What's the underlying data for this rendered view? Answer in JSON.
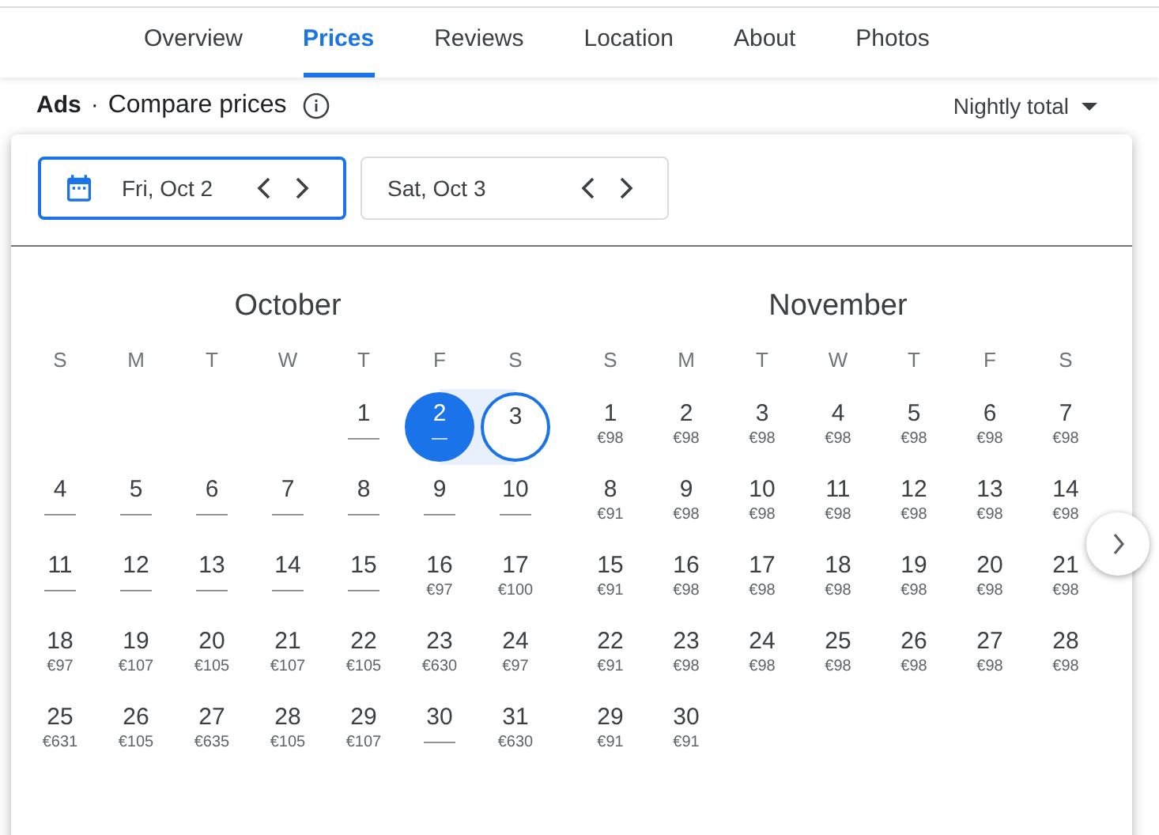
{
  "tabs": [
    {
      "label": "Overview",
      "selected": false
    },
    {
      "label": "Prices",
      "selected": true
    },
    {
      "label": "Reviews",
      "selected": false
    },
    {
      "label": "Location",
      "selected": false
    },
    {
      "label": "About",
      "selected": false
    },
    {
      "label": "Photos",
      "selected": false
    }
  ],
  "header": {
    "ads": "Ads",
    "separator": "·",
    "title": "Compare prices",
    "sort": "Nightly total"
  },
  "date_fields": [
    {
      "value": "Fri, Oct 2",
      "selected": true
    },
    {
      "value": "Sat, Oct 3",
      "selected": false
    }
  ],
  "months": [
    {
      "name": "October",
      "weekdays": [
        "S",
        "M",
        "T",
        "W",
        "T",
        "F",
        "S"
      ],
      "weeks": [
        {
          "kind": "first",
          "days": [
            {
              "day": "1",
              "price": "——",
              "selected": false
            },
            {
              "day": "2",
              "price": "—",
              "selected": true,
              "kind": "start"
            },
            {
              "day": "3",
              "selected": true,
              "kind": "end"
            }
          ]
        },
        {
          "days": [
            {
              "day": "4",
              "price": "——",
              "selected": false
            },
            {
              "day": "5",
              "price": "——",
              "selected": false
            },
            {
              "day": "6",
              "price": "——",
              "selected": false
            },
            {
              "day": "7",
              "price": "——",
              "selected": false
            },
            {
              "day": "8",
              "price": "——",
              "selected": false
            },
            {
              "day": "9",
              "price": "——",
              "selected": false
            },
            {
              "day": "10",
              "price": "——",
              "selected": false
            }
          ]
        },
        {
          "days": [
            {
              "day": "11",
              "price": "——",
              "selected": false
            },
            {
              "day": "12",
              "price": "——",
              "selected": false
            },
            {
              "day": "13",
              "price": "——",
              "selected": false
            },
            {
              "day": "14",
              "price": "——",
              "selected": false
            },
            {
              "day": "15",
              "price": "——",
              "selected": false
            },
            {
              "day": "16",
              "price": "€97",
              "selected": false
            },
            {
              "day": "17",
              "price": "€100",
              "selected": false
            }
          ]
        },
        {
          "days": [
            {
              "day": "18",
              "price": "€97",
              "selected": false
            },
            {
              "day": "19",
              "price": "€107",
              "selected": false
            },
            {
              "day": "20",
              "price": "€105",
              "selected": false
            },
            {
              "day": "21",
              "price": "€107",
              "selected": false
            },
            {
              "day": "22",
              "price": "€105",
              "selected": false
            },
            {
              "day": "23",
              "price": "€630",
              "selected": false
            },
            {
              "day": "24",
              "price": "€97",
              "selected": false
            }
          ]
        },
        {
          "days": [
            {
              "day": "25",
              "price": "€631",
              "selected": false
            },
            {
              "day": "26",
              "price": "€105",
              "selected": false
            },
            {
              "day": "27",
              "price": "€635",
              "selected": false
            },
            {
              "day": "28",
              "price": "€105",
              "selected": false
            },
            {
              "day": "29",
              "price": "€107",
              "selected": false
            },
            {
              "day": "30",
              "price": "——",
              "selected": false
            },
            {
              "day": "31",
              "price": "€630",
              "selected": false
            }
          ]
        }
      ]
    },
    {
      "name": "November",
      "weekdays": [
        "S",
        "M",
        "T",
        "W",
        "T",
        "F",
        "S"
      ],
      "weeks": [
        {
          "days": [
            {
              "day": "1",
              "price": "€98",
              "selected": false
            },
            {
              "day": "2",
              "price": "€98",
              "selected": false
            },
            {
              "day": "3",
              "price": "€98",
              "selected": false
            },
            {
              "day": "4",
              "price": "€98",
              "selected": false
            },
            {
              "day": "5",
              "price": "€98",
              "selected": false
            },
            {
              "day": "6",
              "price": "€98",
              "selected": false
            },
            {
              "day": "7",
              "price": "€98",
              "selected": false
            }
          ]
        },
        {
          "days": [
            {
              "day": "8",
              "price": "€91",
              "selected": false
            },
            {
              "day": "9",
              "price": "€98",
              "selected": false
            },
            {
              "day": "10",
              "price": "€98",
              "selected": false
            },
            {
              "day": "11",
              "price": "€98",
              "selected": false
            },
            {
              "day": "12",
              "price": "€98",
              "selected": false
            },
            {
              "day": "13",
              "price": "€98",
              "selected": false
            },
            {
              "day": "14",
              "price": "€98",
              "selected": false
            }
          ]
        },
        {
          "days": [
            {
              "day": "15",
              "price": "€91",
              "selected": false
            },
            {
              "day": "16",
              "price": "€98",
              "selected": false
            },
            {
              "day": "17",
              "price": "€98",
              "selected": false
            },
            {
              "day": "18",
              "price": "€98",
              "selected": false
            },
            {
              "day": "19",
              "price": "€98",
              "selected": false
            },
            {
              "day": "20",
              "price": "€98",
              "selected": false
            },
            {
              "day": "21",
              "price": "€98",
              "selected": false
            }
          ]
        },
        {
          "days": [
            {
              "day": "22",
              "price": "€91",
              "selected": false
            },
            {
              "day": "23",
              "price": "€98",
              "selected": false
            },
            {
              "day": "24",
              "price": "€98",
              "selected": false
            },
            {
              "day": "25",
              "price": "€98",
              "selected": false
            },
            {
              "day": "26",
              "price": "€98",
              "selected": false
            },
            {
              "day": "27",
              "price": "€98",
              "selected": false
            },
            {
              "day": "28",
              "price": "€98",
              "selected": false
            }
          ]
        },
        {
          "days": [
            {
              "day": "29",
              "price": "€91",
              "selected": false
            },
            {
              "day": "30",
              "price": "€91",
              "selected": false
            }
          ]
        }
      ]
    }
  ]
}
